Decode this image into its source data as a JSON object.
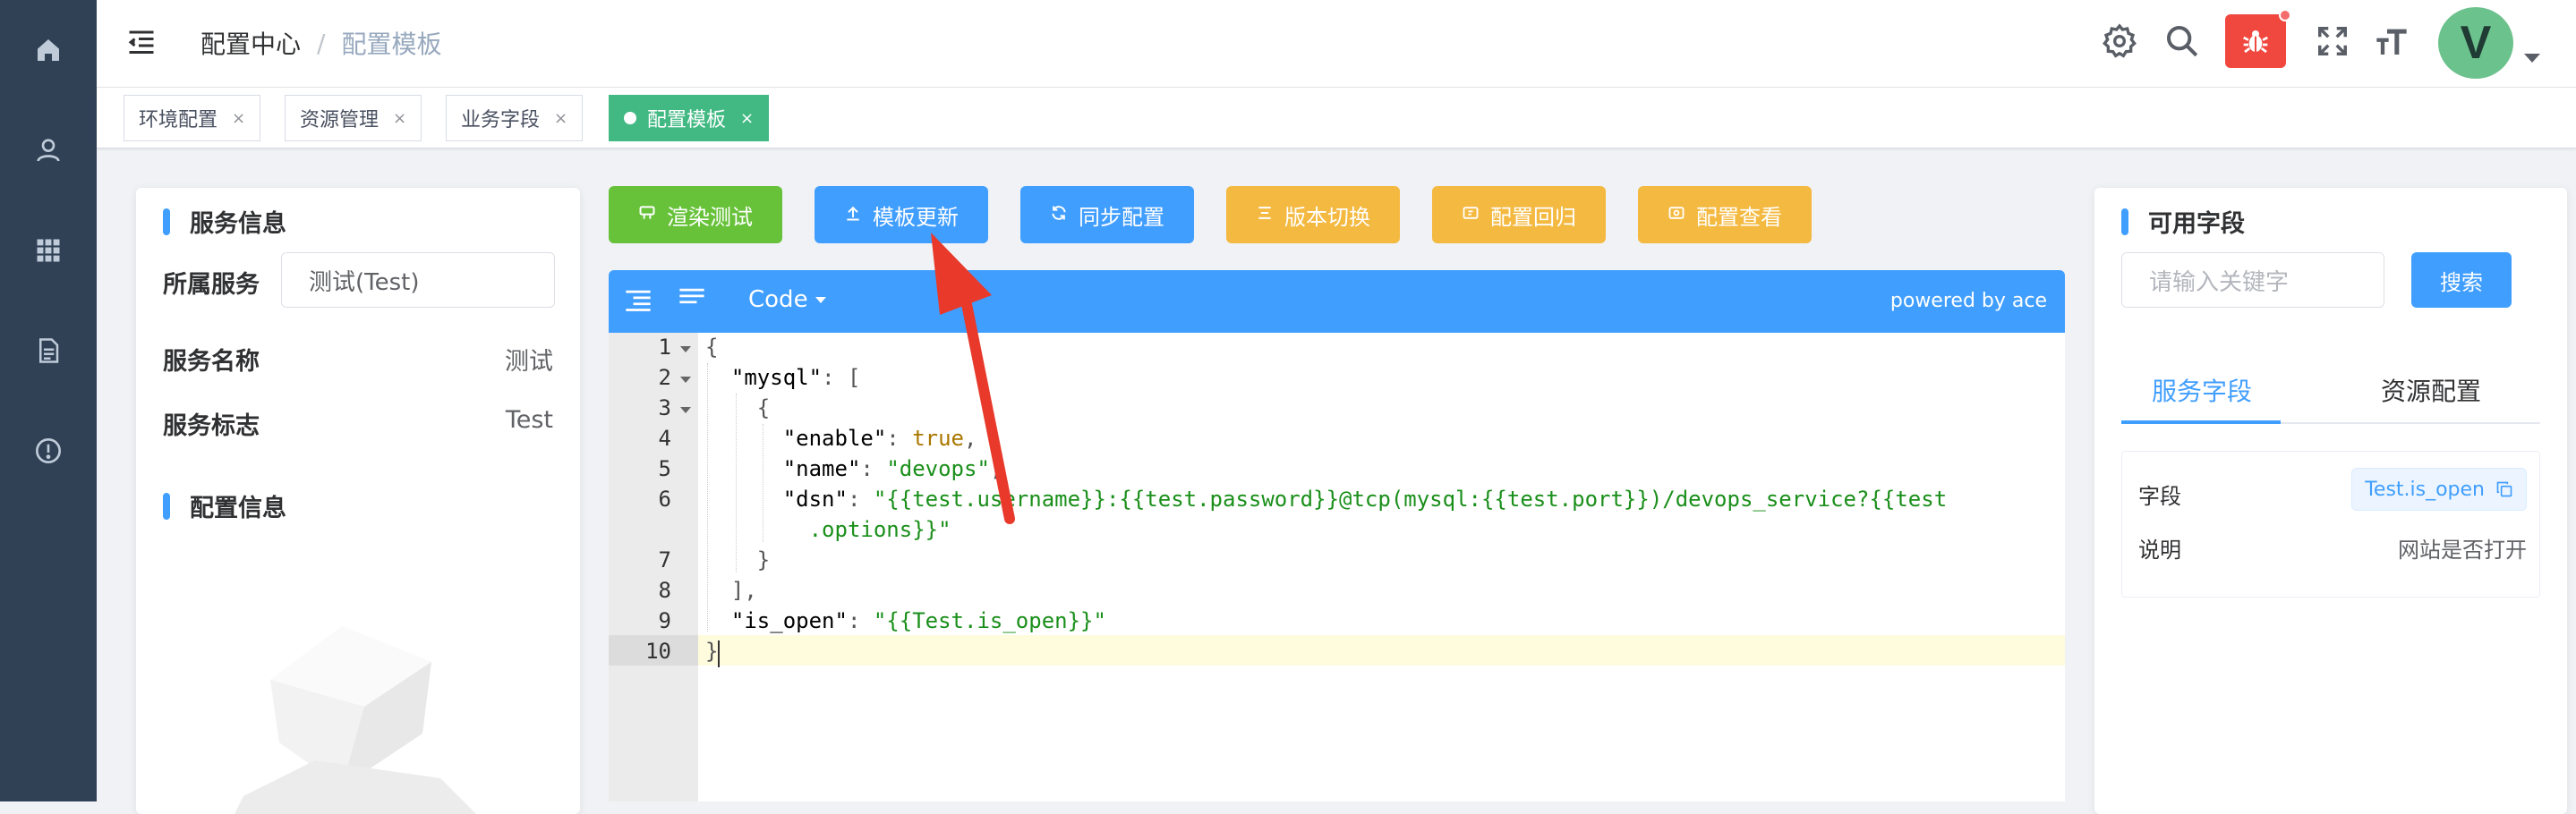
{
  "breadcrumb": {
    "root": "配置中心",
    "separator": "/",
    "current": "配置模板"
  },
  "tags": [
    {
      "label": "环境配置",
      "close": "×"
    },
    {
      "label": "资源管理",
      "close": "×"
    },
    {
      "label": "业务字段",
      "close": "×"
    },
    {
      "label": "配置模板",
      "close": "×",
      "active": true
    }
  ],
  "user": {
    "avatar_letter": "V"
  },
  "left_panel": {
    "service_section_title": "服务信息",
    "owner_label": "所属服务",
    "owner_value": "测试(Test)",
    "name_label": "服务名称",
    "name_value": "测试",
    "id_label": "服务标志",
    "id_value": "Test",
    "config_section_title": "配置信息"
  },
  "toolbar": {
    "buttons": [
      {
        "label": "渲染测试",
        "color": "#67c23a",
        "icon": "render-icon"
      },
      {
        "label": "模板更新",
        "color": "#409eff",
        "icon": "upload-icon"
      },
      {
        "label": "同步配置",
        "color": "#409eff",
        "icon": "refresh-icon"
      },
      {
        "label": "版本切换",
        "color": "#f4b940",
        "icon": "list-icon"
      },
      {
        "label": "配置回归",
        "color": "#f4b940",
        "icon": "rollback-icon"
      },
      {
        "label": "配置查看",
        "color": "#f4b940",
        "icon": "view-icon"
      }
    ]
  },
  "editor": {
    "mode_label": "Code",
    "powered_by": "powered by ace",
    "line_numbers": [
      "1",
      "2",
      "3",
      "4",
      "5",
      "6",
      "7",
      "8",
      "9",
      "10"
    ],
    "active_line": 10
  },
  "right_panel": {
    "section_title": "可用字段",
    "search_placeholder": "请输入关键字",
    "search_button": "搜索",
    "tabs": [
      "服务字段",
      "资源配置"
    ],
    "field_label": "字段",
    "field_value": "Test.is_open",
    "desc_label": "说明",
    "desc_value": "网站是否打开"
  },
  "colors": {
    "sidebar": "#304156",
    "primary": "#409eff",
    "success": "#42b983",
    "warning": "#f4b940",
    "danger": "#f0473f"
  }
}
